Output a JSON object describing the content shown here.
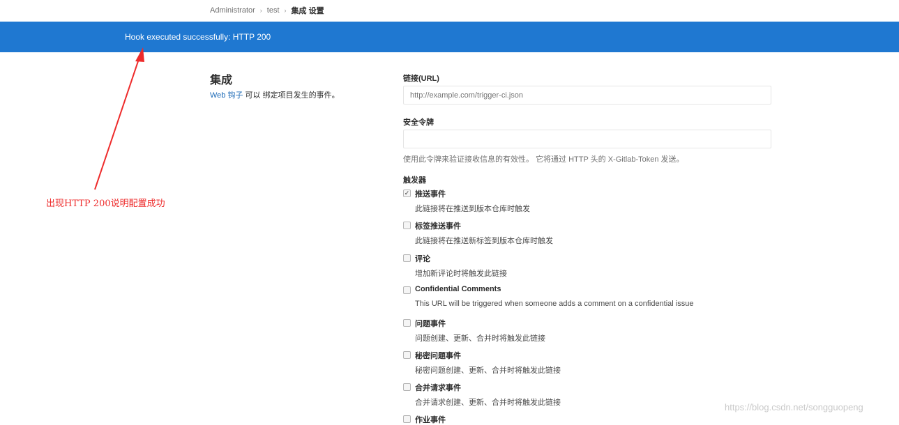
{
  "breadcrumb": {
    "items": [
      "Administrator",
      "test",
      "集成 设置"
    ]
  },
  "flash": {
    "message": "Hook executed successfully: HTTP 200"
  },
  "annotation": {
    "text": "出现HTTP 200说明配置成功",
    "color": "#ee2b2b"
  },
  "side": {
    "title": "集成",
    "link_text": "Web 钩子",
    "desc_rest": " 可以 绑定项目发生的事件。"
  },
  "url_field": {
    "label": "链接(URL)",
    "placeholder": "http://example.com/trigger-ci.json"
  },
  "token_field": {
    "label": "安全令牌",
    "value": "",
    "help": "使用此令牌来验证接收信息的有效性。 它将通过 HTTP 头的 X-Gitlab-Token 发送。"
  },
  "triggers": {
    "heading": "触发器",
    "items": [
      {
        "label": "推送事件",
        "desc": "此链接将在推送到版本仓库时触发",
        "checked": true
      },
      {
        "label": "标签推送事件",
        "desc": "此链接将在推送新标签到版本仓库时触发",
        "checked": false
      },
      {
        "label": "评论",
        "desc": "增加新评论时将触发此链接",
        "checked": false
      },
      {
        "label": "Confidential Comments",
        "desc": "This URL will be triggered when someone adds a comment on a confidential issue",
        "checked": false
      },
      {
        "label": "问题事件",
        "desc": "问题创建、更新、合并时将触发此链接",
        "checked": false
      },
      {
        "label": "秘密问题事件",
        "desc": "秘密问题创建、更新、合并时将触发此链接",
        "checked": false
      },
      {
        "label": "合并请求事件",
        "desc": "合并请求创建、更新、合并时将触发此链接",
        "checked": false
      },
      {
        "label": "作业事件",
        "desc": "",
        "checked": false
      }
    ]
  },
  "watermark": "https://blog.csdn.net/songguopeng",
  "colors": {
    "flash_bg": "#1f78d1",
    "link": "#1b69b6"
  }
}
